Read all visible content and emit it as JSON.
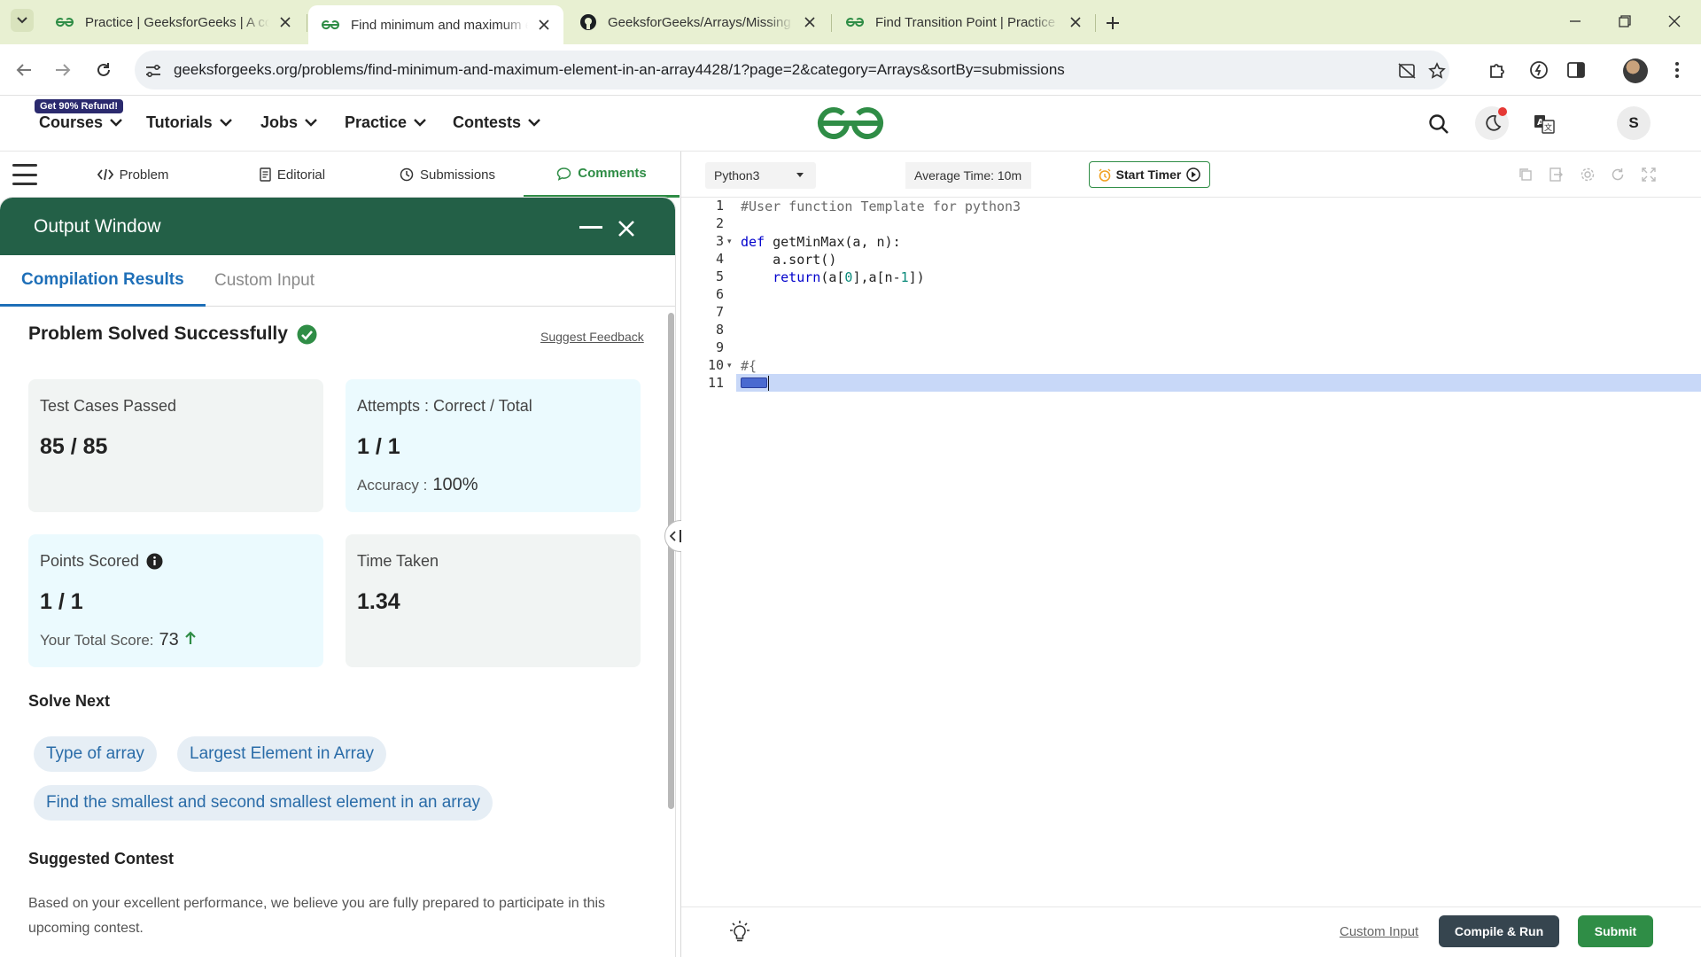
{
  "browser": {
    "tabs": [
      {
        "title": "Practice | GeeksforGeeks | A computer science portal for geeks",
        "icon": "gfg-favicon"
      },
      {
        "title": "Find minimum and maximum element in an array",
        "icon": "gfg-favicon"
      },
      {
        "title": "GeeksforGeeks/Arrays/Missing number in array",
        "icon": "github-favicon"
      },
      {
        "title": "Find Transition Point | Practice | GeeksforGeeks",
        "icon": "gfg-favicon"
      }
    ],
    "url": "geeksforgeeks.org/problems/find-minimum-and-maximum-element-in-an-array4428/1?page=2&category=Arrays&sortBy=submissions"
  },
  "header": {
    "refund_badge": "Get 90% Refund!",
    "nav": [
      "Courses",
      "Tutorials",
      "Jobs",
      "Practice",
      "Contests"
    ],
    "avatar_letter": "S"
  },
  "problem_tabs": [
    "Problem",
    "Editorial",
    "Submissions",
    "Comments"
  ],
  "output": {
    "title": "Output Window",
    "tabs": [
      "Compilation Results",
      "Custom Input"
    ],
    "result_title": "Problem Solved Successfully",
    "suggest_feedback": "Suggest Feedback",
    "cards": {
      "tests_label": "Test Cases Passed",
      "tests_value": "85 / 85",
      "attempts_label": "Attempts : Correct / Total",
      "attempts_value": "1 / 1",
      "accuracy_label": "Accuracy :",
      "accuracy_value": "100%",
      "points_label": "Points Scored",
      "points_value": "1 / 1",
      "total_score_label": "Your Total Score:",
      "total_score_value": "73",
      "time_label": "Time Taken",
      "time_value": "1.34"
    },
    "solve_next_title": "Solve Next",
    "solve_next": [
      "Type of array",
      "Largest Element in Array",
      "Find the smallest and second smallest element in an array"
    ],
    "contest_title": "Suggested Contest",
    "contest_text": "Based on your excellent performance, we believe you are fully prepared to participate in this upcoming contest."
  },
  "editor": {
    "language": "Python3",
    "avg_time": "Average Time: 10m",
    "start_timer": "Start Timer",
    "line_numbers": [
      "1",
      "2",
      "3",
      "4",
      "5",
      "6",
      "7",
      "8",
      "9",
      "10",
      "11"
    ],
    "code": {
      "l1": "#User function Template for python3",
      "l3_kw": "def",
      "l3_rest": " getMinMax(a, n):",
      "l4": "    a.sort()",
      "l5_kw": "    return",
      "l5_a": "(a[",
      "l5_b": "0",
      "l5_c": "],a[n-",
      "l5_d": "1",
      "l5_e": "])",
      "l10": "#{"
    },
    "custom_input": "Custom Input",
    "compile_run": "Compile & Run",
    "submit": "Submit"
  },
  "colors": {
    "brand_green": "#2f8d46",
    "output_header": "#236047",
    "link_blue": "#1e6fb8"
  }
}
